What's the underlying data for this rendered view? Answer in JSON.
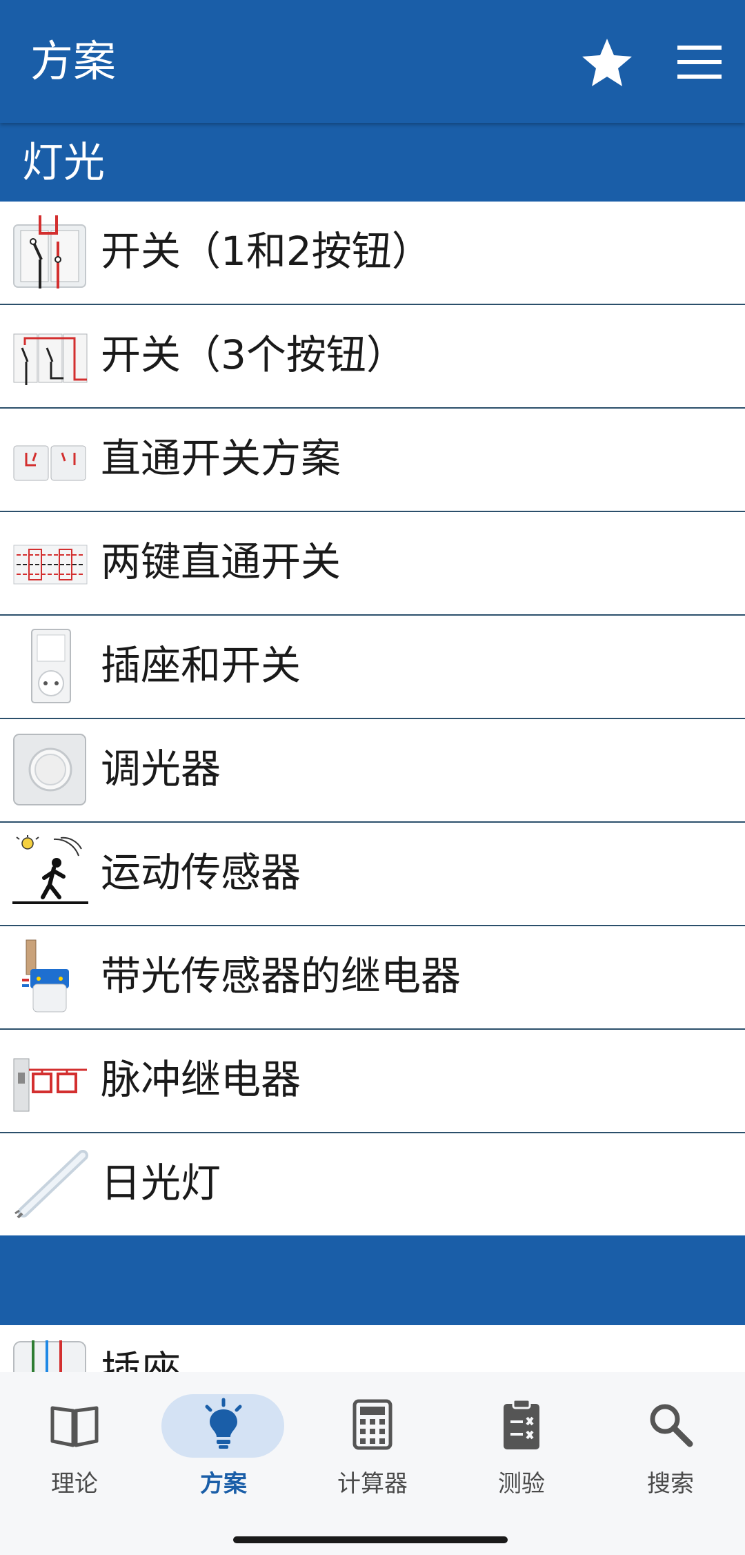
{
  "header": {
    "title": "方案"
  },
  "section": {
    "title": "灯光"
  },
  "items": [
    {
      "label": "开关（1和2按钮）",
      "icon": "switch-1-2-icon"
    },
    {
      "label": "开关（3个按钮）",
      "icon": "switch-3-icon"
    },
    {
      "label": "直通开关方案",
      "icon": "pass-through-switch-icon"
    },
    {
      "label": "两键直通开关",
      "icon": "two-key-pass-through-icon"
    },
    {
      "label": "插座和开关",
      "icon": "socket-switch-icon"
    },
    {
      "label": "调光器",
      "icon": "dimmer-icon"
    },
    {
      "label": "运动传感器",
      "icon": "motion-sensor-icon"
    },
    {
      "label": "带光传感器的继电器",
      "icon": "light-sensor-relay-icon"
    },
    {
      "label": "脉冲继电器",
      "icon": "impulse-relay-icon"
    },
    {
      "label": "日光灯",
      "icon": "fluorescent-lamp-icon"
    }
  ],
  "next_item": {
    "label": "插座",
    "icon": "socket-icon"
  },
  "bottom_nav": [
    {
      "label": "理论",
      "icon": "book-icon",
      "active": false
    },
    {
      "label": "方案",
      "icon": "lightbulb-icon",
      "active": true
    },
    {
      "label": "计算器",
      "icon": "calculator-icon",
      "active": false
    },
    {
      "label": "测验",
      "icon": "clipboard-quiz-icon",
      "active": false
    },
    {
      "label": "搜索",
      "icon": "search-icon",
      "active": false
    }
  ],
  "colors": {
    "primary": "#1a5ea8",
    "active_pill": "#d4e2f4",
    "divider": "#2b4f6b"
  }
}
